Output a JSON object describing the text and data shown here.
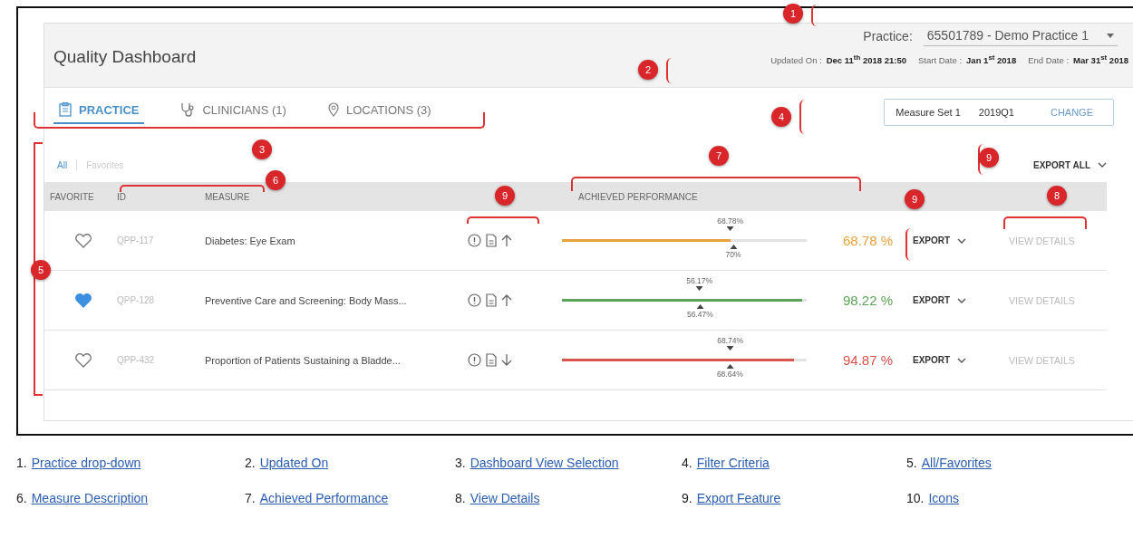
{
  "dashboard": {
    "title": "Quality Dashboard",
    "practice": {
      "label": "Practice:",
      "value": "65501789 - Demo Practice 1"
    },
    "dates": [
      {
        "label": "Updated On :",
        "value": "Dec 11$^{th}$ 2018 21:50"
      },
      {
        "label": "Start Date :",
        "value": "Jan 1$^{st}$ 2018"
      },
      {
        "label": "End Date :",
        "value": "Mar 31$^{st}$ 2018"
      }
    ],
    "tabs": [
      {
        "label": "PRACTICE",
        "kind": "clipboard",
        "selected": true
      },
      {
        "label": "CLINICIANS (1)",
        "kind": "stethoscope",
        "selected": false
      },
      {
        "label": "LOCATIONS (3)",
        "kind": "pin",
        "selected": false
      }
    ],
    "filter": {
      "measure_set": "Measure Set 1",
      "period": "2019Q1",
      "action": "CHANGE"
    },
    "views": [
      {
        "label": "All",
        "selected": true
      },
      {
        "label": "Favorites",
        "selected": false
      }
    ],
    "export_all": "EXPORT ALL",
    "columns": [
      "FAVORITE",
      "ID",
      "MEASURE",
      "ACHIEVED PERFORMANCE"
    ],
    "rows": [
      {
        "favorite": false,
        "id": "QPP-117",
        "measure": "Diabetes: Eye Exam",
        "rising": true,
        "level": 0.6878,
        "color": "#e8a23c",
        "upper": "68.78%",
        "lower": "70%",
        "value": "68.78 %",
        "export": "EXPORT",
        "details": "VIEW DETAILS"
      },
      {
        "favorite": true,
        "id": "QPP-128",
        "measure": "Preventive Care and Screening: Body Mass...",
        "rising": true,
        "level": 0.9822,
        "color": "#5ea35a",
        "upper": "56.17%",
        "lower": "56.47%",
        "value": "98.22 %",
        "export": "EXPORT",
        "details": "VIEW DETAILS"
      },
      {
        "favorite": false,
        "id": "QPP-432",
        "measure": "Proportion of Patients Sustaining a Bladde...",
        "rising": false,
        "level": 0.9487,
        "color": "#d9534f",
        "upper": "68.74%",
        "lower": "68.64%",
        "value": "94.87 %",
        "export": "EXPORT",
        "details": "VIEW DETAILS"
      }
    ]
  },
  "callouts": [
    {
      "number": "1"
    },
    {
      "number": "2"
    },
    {
      "number": "3"
    },
    {
      "number": "4"
    },
    {
      "number": "5"
    },
    {
      "number": "6"
    },
    {
      "number": "9"
    },
    {
      "number": "7"
    },
    {
      "number": "9"
    },
    {
      "number": "9"
    },
    {
      "number": "8"
    }
  ],
  "legend": [
    {
      "number": "1.",
      "label": "Practice drop-down"
    },
    {
      "number": "2.",
      "label": "Updated On"
    },
    {
      "number": "3.",
      "label": "Dashboard View Selection"
    },
    {
      "number": "4.",
      "label": "Filter Criteria"
    },
    {
      "number": "5.",
      "label": "All/Favorites"
    },
    {
      "number": "6.",
      "label": "Measure Description"
    },
    {
      "number": "7.",
      "label": "Achieved Performance"
    },
    {
      "number": "8.",
      "label": "View Details"
    },
    {
      "number": "9.",
      "label": "Export Feature"
    },
    {
      "number": "10.",
      "label": "Icons"
    }
  ]
}
